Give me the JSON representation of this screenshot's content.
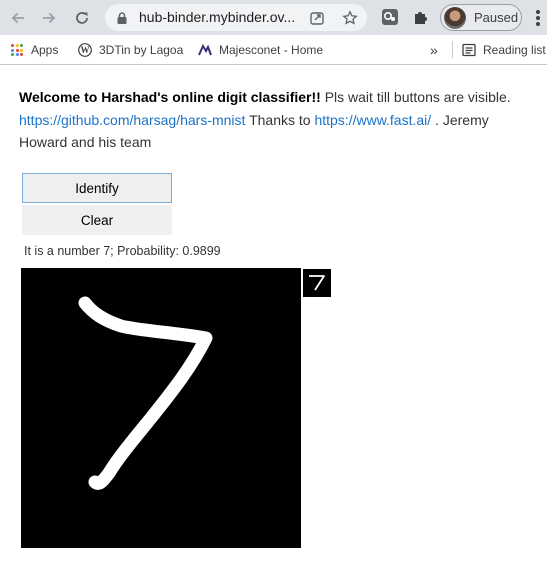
{
  "browser": {
    "url": "hub-binder.mybinder.ov...",
    "profile_label": "Paused",
    "nav_icons": [
      "back-arrow-icon",
      "forward-arrow-icon",
      "reload-icon"
    ],
    "bookmarks": [
      {
        "label": "Apps",
        "icon": "apps-grid-icon"
      },
      {
        "label": "3DTin by Lagoa",
        "icon": "wordpress-icon"
      },
      {
        "label": "Majesconet - Home",
        "icon": "majesconet-logo-icon"
      }
    ],
    "reading_list": "Reading list",
    "overflow": "»"
  },
  "page": {
    "intro_bold": "Welcome to Harshad's online digit classifier!!",
    "intro_rest": " Pls wait till buttons are visible.",
    "link_github": "https://github.com/harsag/hars-mnist",
    "thanks_text": " Thanks to ",
    "link_fastai": "https://www.fast.ai/",
    "credit_text": " . Jeremy Howard and his team",
    "identify_label": "Identify",
    "clear_label": "Clear",
    "result_text": "It is a number 7; Probability: 0.9899",
    "predicted_digit": "7"
  },
  "colors": {
    "link": "#1a73c8",
    "canvas_bg": "#000000",
    "stroke": "#ffffff",
    "focus_border": "#7aaed8"
  }
}
